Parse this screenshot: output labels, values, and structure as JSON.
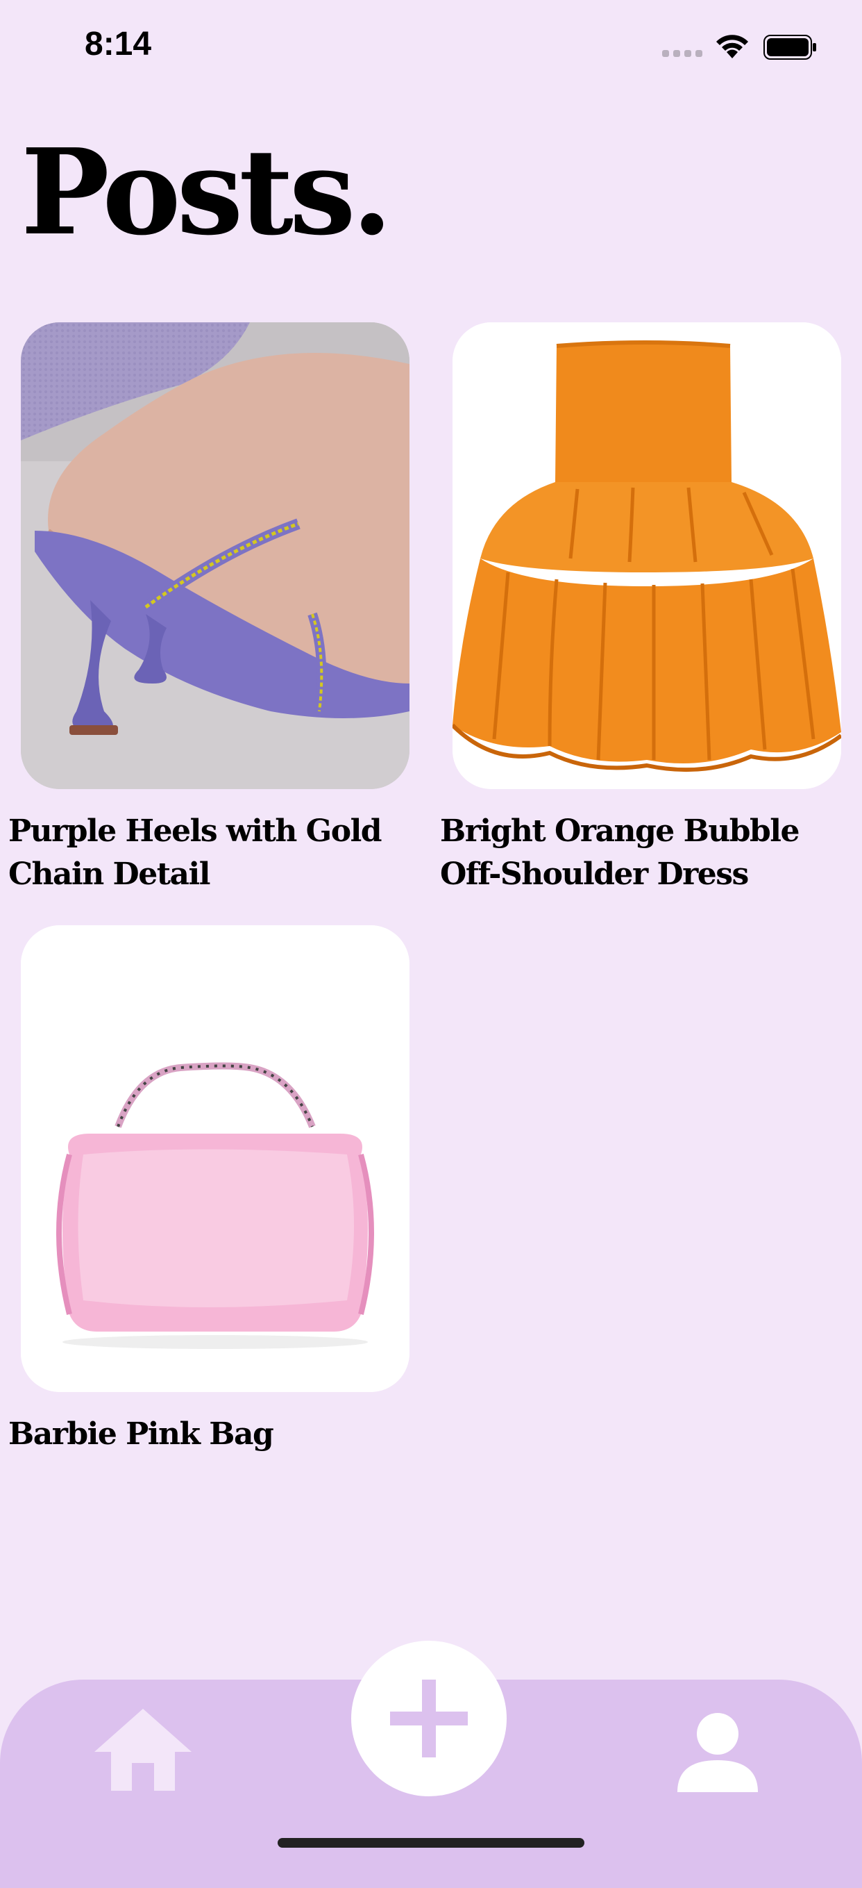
{
  "status_bar": {
    "time": "8:14",
    "icons": [
      "signal-icon",
      "wifi-icon",
      "battery-icon"
    ]
  },
  "page": {
    "title": "Posts."
  },
  "posts": [
    {
      "title": "Purple Heels with Gold Chain Detail",
      "image": "purple-heels-image"
    },
    {
      "title": "Bright Orange Bubble Off-Shoulder Dress",
      "image": "orange-dress-image"
    },
    {
      "title": "Barbie Pink Bag",
      "image": "pink-bag-image"
    }
  ],
  "tab_bar": {
    "items": [
      "home-icon",
      "add-icon",
      "profile-icon"
    ]
  },
  "colors": {
    "background": "#f3e6f9",
    "tab_bar": "#dcc1ee",
    "tab_icon": "#f3e6f9",
    "plus": "#dcc1ee",
    "card": "#ffffff"
  }
}
